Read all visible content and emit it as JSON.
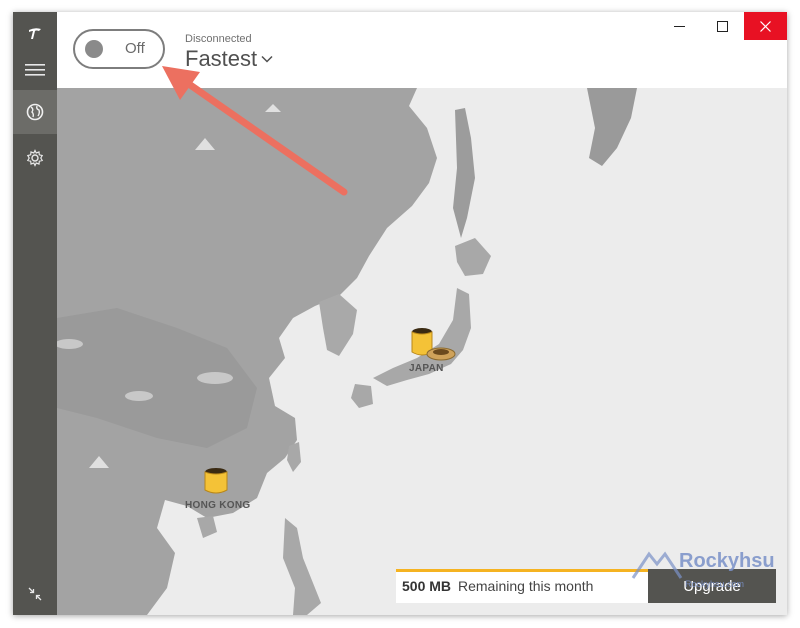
{
  "app": {
    "logo_glyph": "T"
  },
  "sidebar": {
    "items": [
      {
        "icon": "menu-icon"
      },
      {
        "icon": "globe-icon",
        "active": true
      },
      {
        "icon": "gear-icon"
      }
    ],
    "bottom_icon": "collapse-icon"
  },
  "header": {
    "toggle": {
      "label": "Off",
      "state": "off"
    },
    "status": "Disconnected",
    "server": "Fastest",
    "server_caret": "⌵"
  },
  "window_controls": {
    "minimize": "—",
    "maximize": "☐",
    "close": "✕"
  },
  "map": {
    "locations": [
      {
        "label": "JAPAN"
      },
      {
        "label": "HONG KONG"
      }
    ]
  },
  "data_usage": {
    "amount": "500 MB",
    "text": "Remaining this month",
    "progress_fraction": 1.0
  },
  "upgrade": {
    "label": "Upgrade"
  },
  "watermark": {
    "text": "Rockyhsu",
    "subtext": "Rockyhsu.com"
  },
  "colors": {
    "sidebar": "#545450",
    "accent_bar": "#f5b321",
    "close_red": "#e81123",
    "arrow": "#ec7060"
  }
}
